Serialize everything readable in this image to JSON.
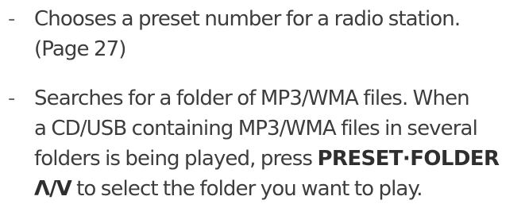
{
  "items": [
    {
      "bullet": "-",
      "lines": [
        "Chooses a preset number for a radio station.",
        "(Page 27)"
      ]
    },
    {
      "bullet": "-",
      "lines": [
        "Searches for a folder of MP3/WMA files. When",
        "a CD/USB containing MP3/WMA files in several"
      ],
      "line3_prefix": "folders is being played, press ",
      "line3_bold": "PRESET·FOLDER",
      "line4_arrow_up": "Λ",
      "line4_separator": "/",
      "line4_arrow_down": "V",
      "line4_rest": " to select the folder you want to play."
    }
  ]
}
